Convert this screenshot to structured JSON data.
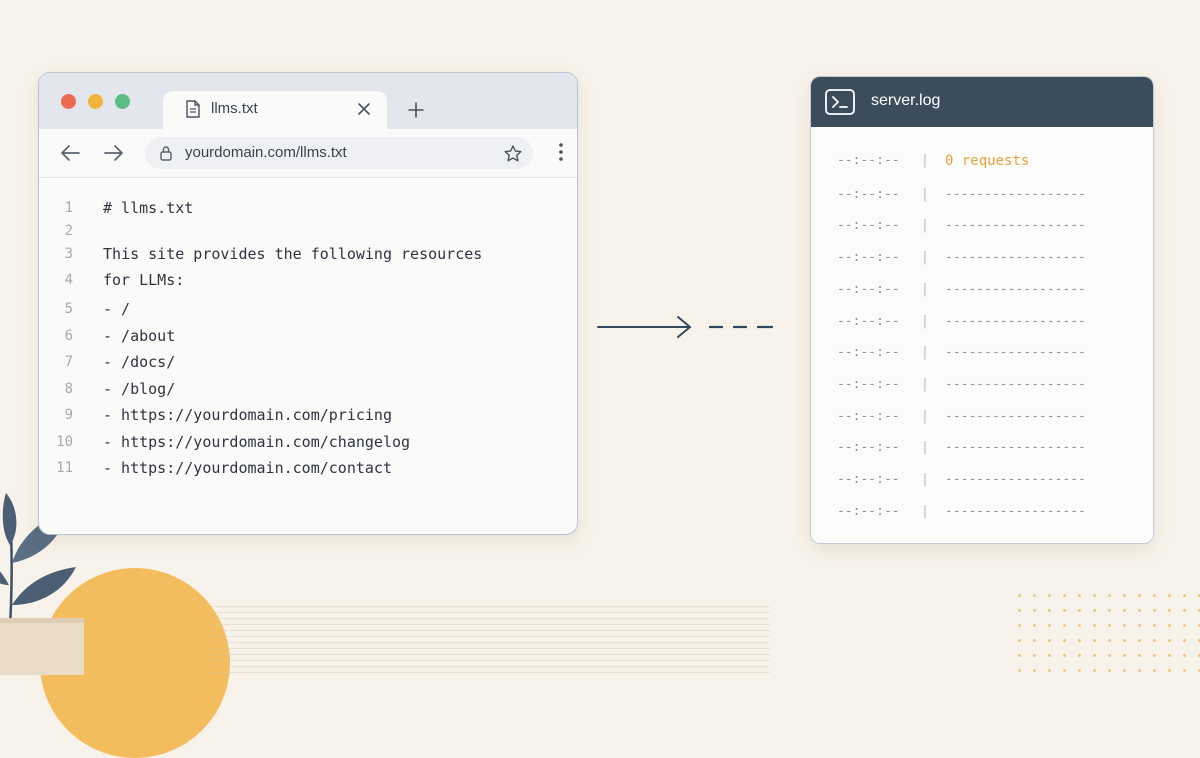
{
  "colors": {
    "background": "#f8f3ea",
    "terminal_header": "#3b4c5c",
    "accent_orange": "#e7a33a",
    "sun": "#f3bd5e",
    "traffic_red": "#ec6a53",
    "traffic_yellow": "#f2b33d",
    "traffic_green": "#5dbb84"
  },
  "browser": {
    "tab": {
      "title": "llms.txt",
      "icon": "document-icon"
    },
    "address_bar": {
      "url": "yourdomain.com/llms.txt"
    },
    "file_lines": [
      {
        "number": "1",
        "text": "# llms.txt"
      },
      {
        "number": "2",
        "text": ""
      },
      {
        "number": "3",
        "text": "This site provides the following resources"
      },
      {
        "number": "4",
        "text": "for LLMs:"
      },
      {
        "number": "5",
        "text": "- /"
      },
      {
        "number": "6",
        "text": "- /about"
      },
      {
        "number": "7",
        "text": "- /docs/"
      },
      {
        "number": "8",
        "text": "- /blog/"
      },
      {
        "number": "9",
        "text": "- https://yourdomain.com/pricing"
      },
      {
        "number": "10",
        "text": "- https://yourdomain.com/changelog"
      },
      {
        "number": "11",
        "text": "- https://yourdomain.com/contact"
      }
    ]
  },
  "server_log": {
    "title": "server.log",
    "icon": "terminal-icon",
    "separator": "|",
    "rows": [
      {
        "time": "--:--:--",
        "text": "0 requests"
      },
      {
        "time": "--:--:--",
        "text": "------------------"
      },
      {
        "time": "--:--:--",
        "text": "------------------"
      },
      {
        "time": "--:--:--",
        "text": "------------------"
      },
      {
        "time": "--:--:--",
        "text": "------------------"
      },
      {
        "time": "--:--:--",
        "text": "------------------"
      },
      {
        "time": "--:--:--",
        "text": "------------------"
      },
      {
        "time": "--:--:--",
        "text": "------------------"
      },
      {
        "time": "--:--:--",
        "text": "------------------"
      },
      {
        "time": "--:--:--",
        "text": "------------------"
      },
      {
        "time": "--:--:--",
        "text": "------------------"
      },
      {
        "time": "--:--:--",
        "text": "------------------"
      }
    ]
  }
}
